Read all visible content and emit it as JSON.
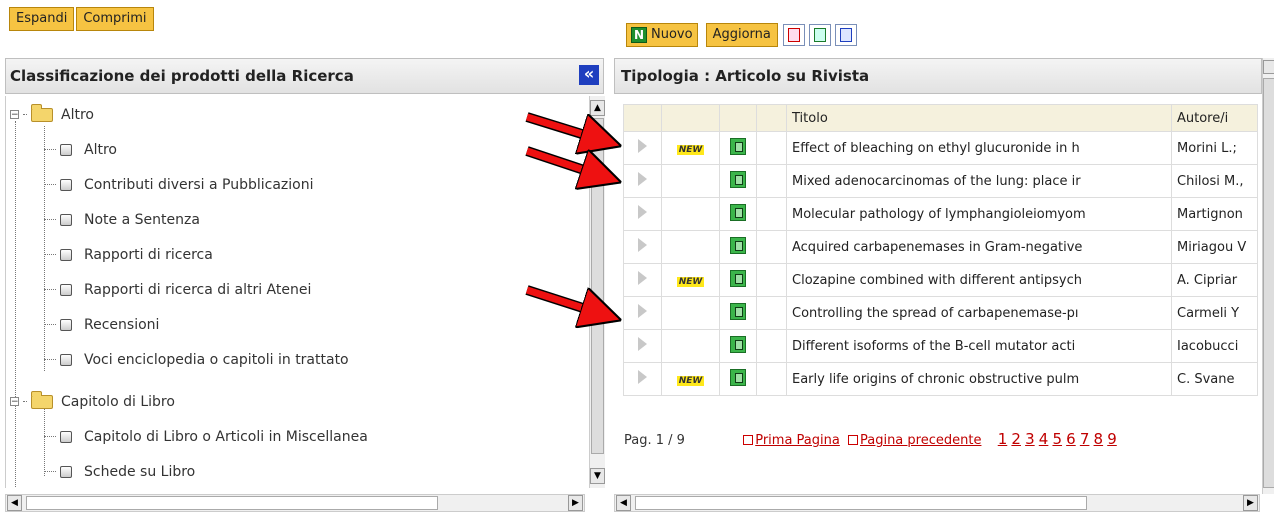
{
  "left_toolbar": {
    "expand": "Espandi",
    "collapse": "Comprimi"
  },
  "left_panel": {
    "title": "Classificazione dei prodotti della Ricerca",
    "collapse_symbol": "«",
    "tree": [
      {
        "label": "Altro",
        "type": "folder",
        "level": 0
      },
      {
        "label": "Altro",
        "type": "file",
        "level": 1
      },
      {
        "label": "Contributi diversi a Pubblicazioni",
        "type": "file",
        "level": 1
      },
      {
        "label": "Note a Sentenza",
        "type": "file",
        "level": 1
      },
      {
        "label": "Rapporti di ricerca",
        "type": "file",
        "level": 1
      },
      {
        "label": "Rapporti di ricerca di altri Atenei",
        "type": "file",
        "level": 1
      },
      {
        "label": "Recensioni",
        "type": "file",
        "level": 1
      },
      {
        "label": "Voci enciclopedia o capitoli in trattato",
        "type": "file",
        "level": 1
      },
      {
        "label": "Capitolo di Libro",
        "type": "folder",
        "level": 0
      },
      {
        "label": "Capitolo di Libro o Articoli in Miscellanea",
        "type": "file",
        "level": 1
      },
      {
        "label": "Schede su Libro",
        "type": "file",
        "level": 1
      }
    ]
  },
  "right_toolbar": {
    "new": "Nuovo",
    "refresh": "Aggiorna"
  },
  "right_panel": {
    "title": "Tipologia : Articolo su Rivista",
    "columns": {
      "title": "Titolo",
      "authors": "Autore/i"
    },
    "new_badge": "NEW",
    "rows": [
      {
        "new": true,
        "title": "Effect of bleaching on ethyl glucuronide in h",
        "authors": "Morini L.;"
      },
      {
        "new": false,
        "title": "Mixed adenocarcinomas of the lung: place ir",
        "authors": "Chilosi M.,"
      },
      {
        "new": false,
        "title": "Molecular pathology of lymphangioleiomyom",
        "authors": "Martignon"
      },
      {
        "new": false,
        "title": "Acquired carbapenemases in Gram-negative",
        "authors": "Miriagou V"
      },
      {
        "new": true,
        "title": "Clozapine combined with different antipsych",
        "authors": "A. Cipriar"
      },
      {
        "new": false,
        "title": "Controlling the spread of carbapenemase-pı",
        "authors": "Carmeli Y"
      },
      {
        "new": false,
        "title": "Different isoforms of the B-cell mutator acti",
        "authors": "Iacobucci"
      },
      {
        "new": true,
        "title": "Early life origins of chronic obstructive pulm",
        "authors": "C. Svane"
      }
    ],
    "pager": {
      "page_info": "Pag. 1 / 9",
      "first": "Prima Pagina",
      "prev": "Pagina precedente",
      "pages": [
        "1",
        "2",
        "3",
        "4",
        "5",
        "6",
        "7",
        "8",
        "9"
      ]
    }
  },
  "colors": {
    "button_yellow": "#f6c342",
    "header_row": "#f5f1dd",
    "lock_green": "#3bb54a",
    "arrow_red": "#ee1111",
    "link_red": "#c00000",
    "collapse_blue": "#1f3fbf"
  }
}
